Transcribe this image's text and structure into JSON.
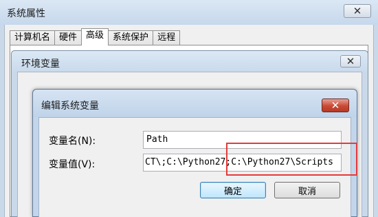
{
  "system_properties": {
    "title": "系统属性",
    "tabs": [
      {
        "label": "计算机名",
        "active": false
      },
      {
        "label": "硬件",
        "active": false
      },
      {
        "label": "高级",
        "active": true
      },
      {
        "label": "系统保护",
        "active": false
      },
      {
        "label": "远程",
        "active": false
      }
    ]
  },
  "env_window": {
    "title": "环境变量"
  },
  "edit_dialog": {
    "title": "编辑系统变量",
    "name_label": "变量名(N):",
    "name_value": "Path",
    "value_label": "变量值(V):",
    "value_value": "CT\\;C:\\Python27;C:\\Python27\\Scripts",
    "ok_label": "确定",
    "cancel_label": "取消"
  },
  "icons": {
    "close": "close-icon"
  },
  "colors": {
    "highlight": "#e53a3a",
    "close_active": "#c84a35"
  }
}
